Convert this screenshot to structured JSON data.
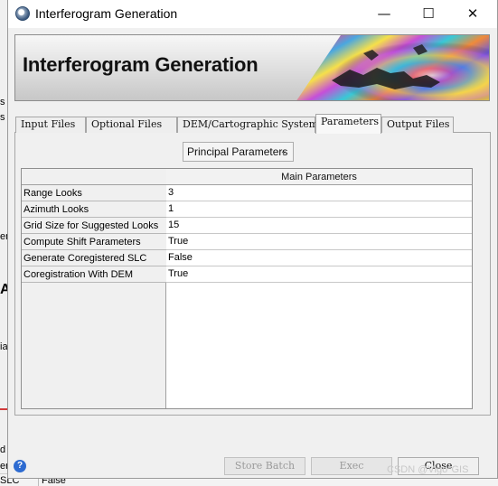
{
  "window": {
    "title": "Interferogram Generation",
    "minimize": "—",
    "maximize": "☐",
    "close": "✕"
  },
  "banner": {
    "title": "Interferogram Generation"
  },
  "tabs": [
    {
      "label": "Input Files"
    },
    {
      "label": "Optional Files"
    },
    {
      "label": "DEM/Cartographic System"
    },
    {
      "label": "Parameters"
    },
    {
      "label": "Output Files"
    }
  ],
  "active_tab": "Parameters",
  "dropdown": {
    "selected": "Principal Parameters",
    "chevron": "⌄"
  },
  "table": {
    "header": "Main Parameters",
    "rows": [
      {
        "label": "Range Looks",
        "value": "3"
      },
      {
        "label": "Azimuth Looks",
        "value": "1"
      },
      {
        "label": "Grid Size for Suggested Looks",
        "value": "15"
      },
      {
        "label": "Compute Shift Parameters",
        "value": "True"
      },
      {
        "label": "Generate Coregistered SLC",
        "value": "False"
      },
      {
        "label": "Coregistration With DEM",
        "value": "True"
      }
    ]
  },
  "footer": {
    "help": "?",
    "store_batch": "Store Batch",
    "exec": "Exec",
    "close": "Close"
  },
  "watermark": "CSDN @Vigo*GIS",
  "background": {
    "fragments": [
      "s",
      "s",
      "en",
      "Al",
      "ial",
      "d",
      "er",
      "SLC",
      "False"
    ]
  }
}
